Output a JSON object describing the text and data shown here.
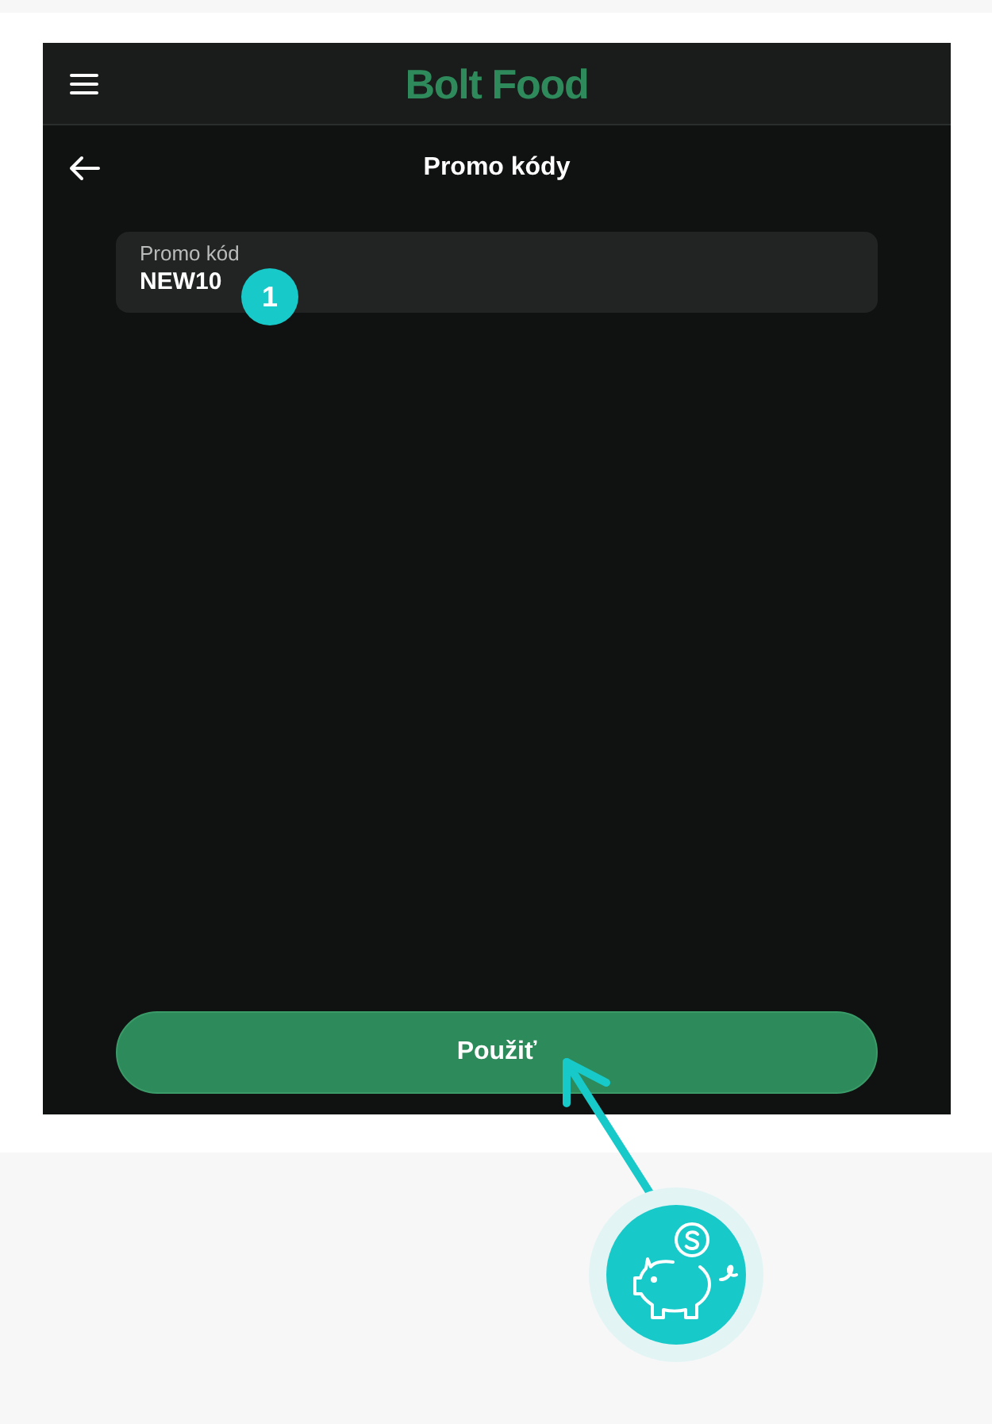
{
  "app_bar": {
    "logo_text": "Bolt Food"
  },
  "page_header": {
    "title": "Promo kódy"
  },
  "promo_code_field": {
    "label": "Promo kód",
    "value": "NEW10"
  },
  "step_badge": {
    "number": "1"
  },
  "apply_button": {
    "label": "Použiť"
  }
}
